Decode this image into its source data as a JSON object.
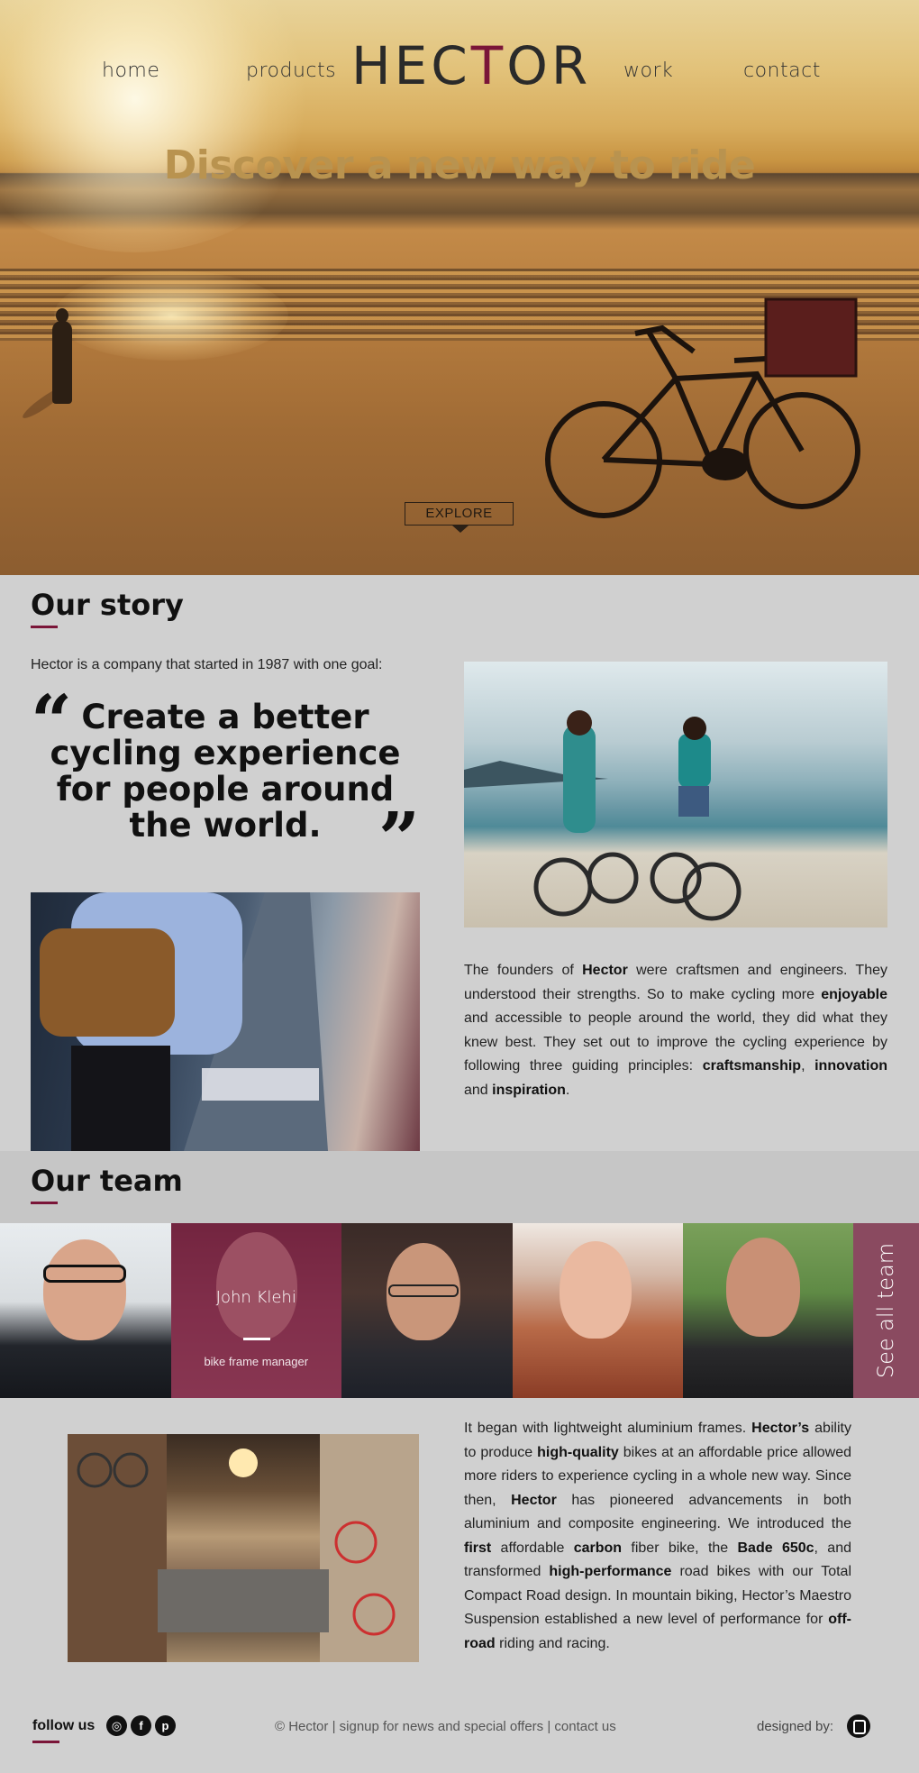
{
  "nav": {
    "home": "home",
    "products": "products",
    "work": "work",
    "contact": "contact"
  },
  "logo": {
    "prefix": "HEC",
    "accent_letter": "T",
    "suffix": "OR"
  },
  "hero": {
    "title": "Discover a new way to ride",
    "explore_label": "EXPLORE"
  },
  "story": {
    "title": "Our story",
    "intro": "Hector is a company that started in 1987 with one goal:",
    "quote": "Create a better cycling experience for people around the world.",
    "paragraph": [
      {
        "t": "The founders of ",
        "b": false
      },
      {
        "t": "Hector",
        "b": true
      },
      {
        "t": " were craftsmen and engineers. They understood their strengths. So to make cycling more ",
        "b": false
      },
      {
        "t": "enjoyable",
        "b": true
      },
      {
        "t": " and accessible to people around the world, they did what they  knew best. They set out to improve the cycling experience by following three guiding principles: ",
        "b": false
      },
      {
        "t": "craftsmanship",
        "b": true
      },
      {
        "t": ", ",
        "b": false
      },
      {
        "t": "innovation",
        "b": true
      },
      {
        "t": " and ",
        "b": false
      },
      {
        "t": "inspiration",
        "b": true
      },
      {
        "t": ".",
        "b": false
      }
    ]
  },
  "team": {
    "title": "Our team",
    "featured_member": {
      "name": "John Klehi",
      "role": "bike frame manager"
    },
    "see_all_label": "See all team"
  },
  "history": {
    "paragraph": [
      {
        "t": "It began with lightweight aluminium frames. ",
        "b": false
      },
      {
        "t": "Hector’s",
        "b": true
      },
      {
        "t": " ability to produce ",
        "b": false
      },
      {
        "t": "high-quality",
        "b": true
      },
      {
        "t": " bikes at an affordable price allowed more riders to experience cycling in a whole new way. Since then, ",
        "b": false
      },
      {
        "t": "Hector",
        "b": true
      },
      {
        "t": " has pioneered advancements in both aluminium and composite engineering. We introduced the ",
        "b": false
      },
      {
        "t": "first",
        "b": true
      },
      {
        "t": " affordable ",
        "b": false
      },
      {
        "t": "carbon",
        "b": true
      },
      {
        "t": " fiber bike, the ",
        "b": false
      },
      {
        "t": "Bade 650c",
        "b": true
      },
      {
        "t": ", and transformed ",
        "b": false
      },
      {
        "t": "high-performance",
        "b": true
      },
      {
        "t": " road bikes with our Total Compact Road design. In mountain biking, Hector’s Maestro Suspension established a new level of performance for ",
        "b": false
      },
      {
        "t": "off-road",
        "b": true
      },
      {
        "t": " riding and racing.",
        "b": false
      }
    ]
  },
  "footer": {
    "follow_label": "follow us",
    "social": {
      "instagram": "instagram-icon",
      "facebook": "facebook-icon",
      "pinterest": "pinterest-icon"
    },
    "copyright": "© Hector",
    "signup_link": "signup for news and special offers",
    "contact_link": "contact us",
    "separator": " | ",
    "designed_by": "designed by:"
  },
  "colors": {
    "accent": "#7a1538",
    "hero_title": "#b9934f",
    "see_all_bg": "#8a4a60",
    "page_bg": "#d0d0d0"
  }
}
